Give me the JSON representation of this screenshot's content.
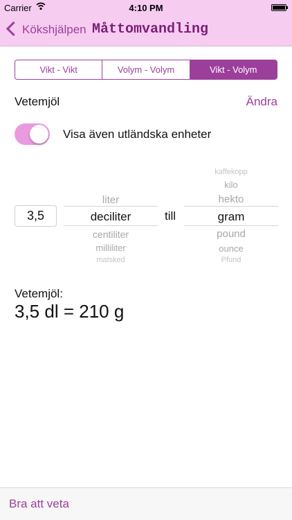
{
  "status": {
    "carrier": "Carrier",
    "time": "4:10 PM"
  },
  "nav": {
    "back_label": "Kökshjälpen",
    "title": "Måttomvandling"
  },
  "segments": [
    {
      "label": "Vikt  - Vikt",
      "active": false
    },
    {
      "label": "Volym - Volym",
      "active": false
    },
    {
      "label": "Vikt - Volym",
      "active": true
    }
  ],
  "ingredient": {
    "name": "Vetemjöl",
    "edit_label": "Ändra"
  },
  "toggle": {
    "label": "Visa även utländska enheter",
    "on": true
  },
  "converter": {
    "quantity": "3,5",
    "from_units": [
      "liter",
      "deciliter",
      "centiliter",
      "milliliter",
      "matsked"
    ],
    "from_selected": "deciliter",
    "connector": "till",
    "to_units": [
      "kaffekopp",
      "kilo",
      "hekto",
      "gram",
      "pound",
      "ounce",
      "Pfund"
    ],
    "to_selected": "gram"
  },
  "result": {
    "label": "Vetemjöl:",
    "value": "3,5 dl = 210 g"
  },
  "bottom": {
    "link_label": "Bra att veta"
  },
  "colors": {
    "accent": "#9c3f9b",
    "bar": "#f6ccf0",
    "toggle_on": "#e99be0"
  }
}
